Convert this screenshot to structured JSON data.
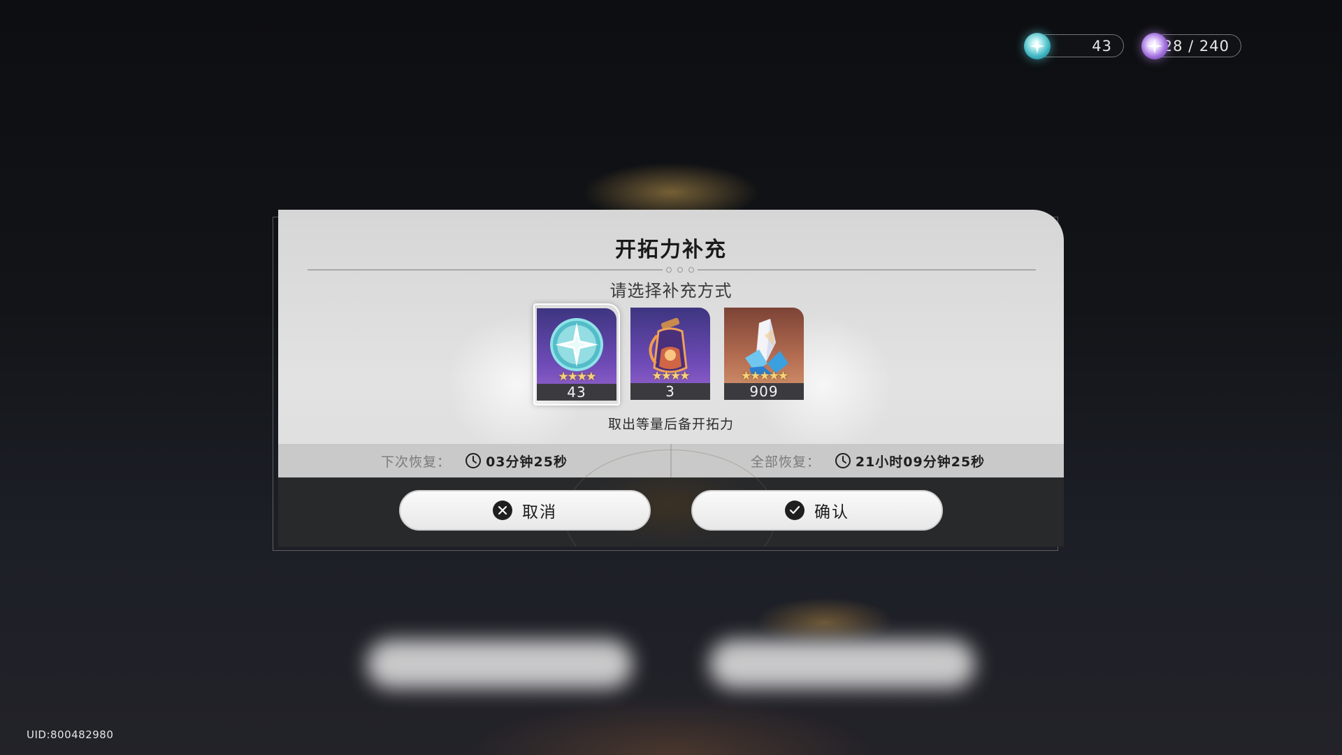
{
  "header": {
    "stellar_jade": {
      "icon": "stellar-jade-icon",
      "value": "43"
    },
    "trailblaze_power": {
      "icon": "trailblaze-power-icon",
      "value": "28 / 240"
    }
  },
  "dialog": {
    "title": "开拓力补充",
    "subtitle": "请选择补充方式",
    "hint": "取出等量后备开拓力",
    "items": [
      {
        "icon": "stellar-jade-icon",
        "count": "43",
        "stars": "★★★★",
        "selected": true
      },
      {
        "icon": "fuel-bottle-icon",
        "count": "3",
        "stars": "★★★★",
        "selected": false
      },
      {
        "icon": "crystal-icon",
        "count": "909",
        "stars": "★★★★★",
        "selected": false
      }
    ],
    "next_recover": {
      "label": "下次恢复：",
      "time": "03分钟25秒"
    },
    "full_recover": {
      "label": "全部恢复：",
      "time": "21小时09分钟25秒"
    },
    "cancel_label": "取消",
    "confirm_label": "确认"
  },
  "footer": {
    "uid": "UID:800482980"
  },
  "colors": {
    "dialog_bg": "#dcdcdc",
    "action_bar": "#28292b",
    "star": "#f6d27a",
    "purple_card": "#6e4bb6",
    "orange_card": "#b56e52"
  }
}
